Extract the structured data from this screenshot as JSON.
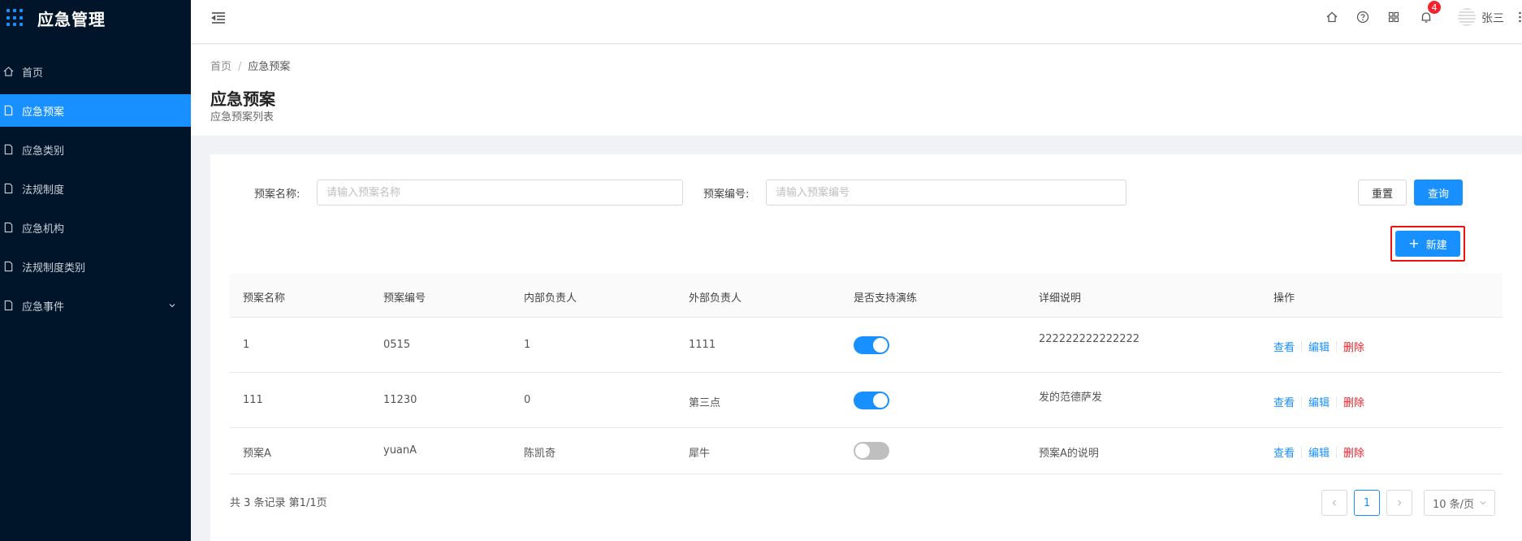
{
  "app": {
    "title": "应急管理"
  },
  "sidebar": {
    "items": [
      {
        "label": "首页",
        "icon": "home-icon"
      },
      {
        "label": "应急预案",
        "icon": "file-icon",
        "active": true
      },
      {
        "label": "应急类别",
        "icon": "file-icon"
      },
      {
        "label": "法规制度",
        "icon": "file-icon"
      },
      {
        "label": "应急机构",
        "icon": "file-icon"
      },
      {
        "label": "法规制度类别",
        "icon": "file-icon"
      },
      {
        "label": "应急事件",
        "icon": "file-icon",
        "expandable": true
      }
    ]
  },
  "header": {
    "notification_count": "4",
    "username": "张三",
    "icons": [
      "menu-fold-icon",
      "home-icon",
      "question-icon",
      "apps-icon",
      "bell-icon",
      "more-icon"
    ]
  },
  "breadcrumb": {
    "home": "首页",
    "separator": "/",
    "current": "应急预案"
  },
  "page": {
    "title": "应急预案",
    "subtitle": "应急预案列表"
  },
  "search": {
    "name_label": "预案名称:",
    "name_placeholder": "请输入预案名称",
    "name_value": "",
    "code_label": "预案编号:",
    "code_placeholder": "请输入预案编号",
    "code_value": "",
    "reset_label": "重置",
    "query_label": "查询"
  },
  "toolbar": {
    "new_label": "新建"
  },
  "table": {
    "columns": [
      "预案名称",
      "预案编号",
      "内部负责人",
      "外部负责人",
      "是否支持演练",
      "详细说明",
      "操作"
    ],
    "rows": [
      {
        "name": "1",
        "code": "0515",
        "internal": "1",
        "external": "1111",
        "drill": true,
        "desc": "222222222222222"
      },
      {
        "name": "111",
        "code": "11230",
        "internal": "0",
        "external": "第三点",
        "drill": true,
        "desc": "发的范德萨发"
      },
      {
        "name": "预案A",
        "code": "yuanA",
        "internal": "陈凯奇",
        "external": "犀牛",
        "drill": false,
        "desc": "预案A的说明"
      }
    ],
    "actions": {
      "view": "查看",
      "edit": "编辑",
      "delete": "删除"
    }
  },
  "pagination": {
    "total_text": "共 3 条记录 第1/1页",
    "current_page": "1",
    "page_size": "10 条/页"
  },
  "colors": {
    "primary": "#1890ff",
    "sidebar_bg": "#001529",
    "danger": "#f5222d"
  }
}
